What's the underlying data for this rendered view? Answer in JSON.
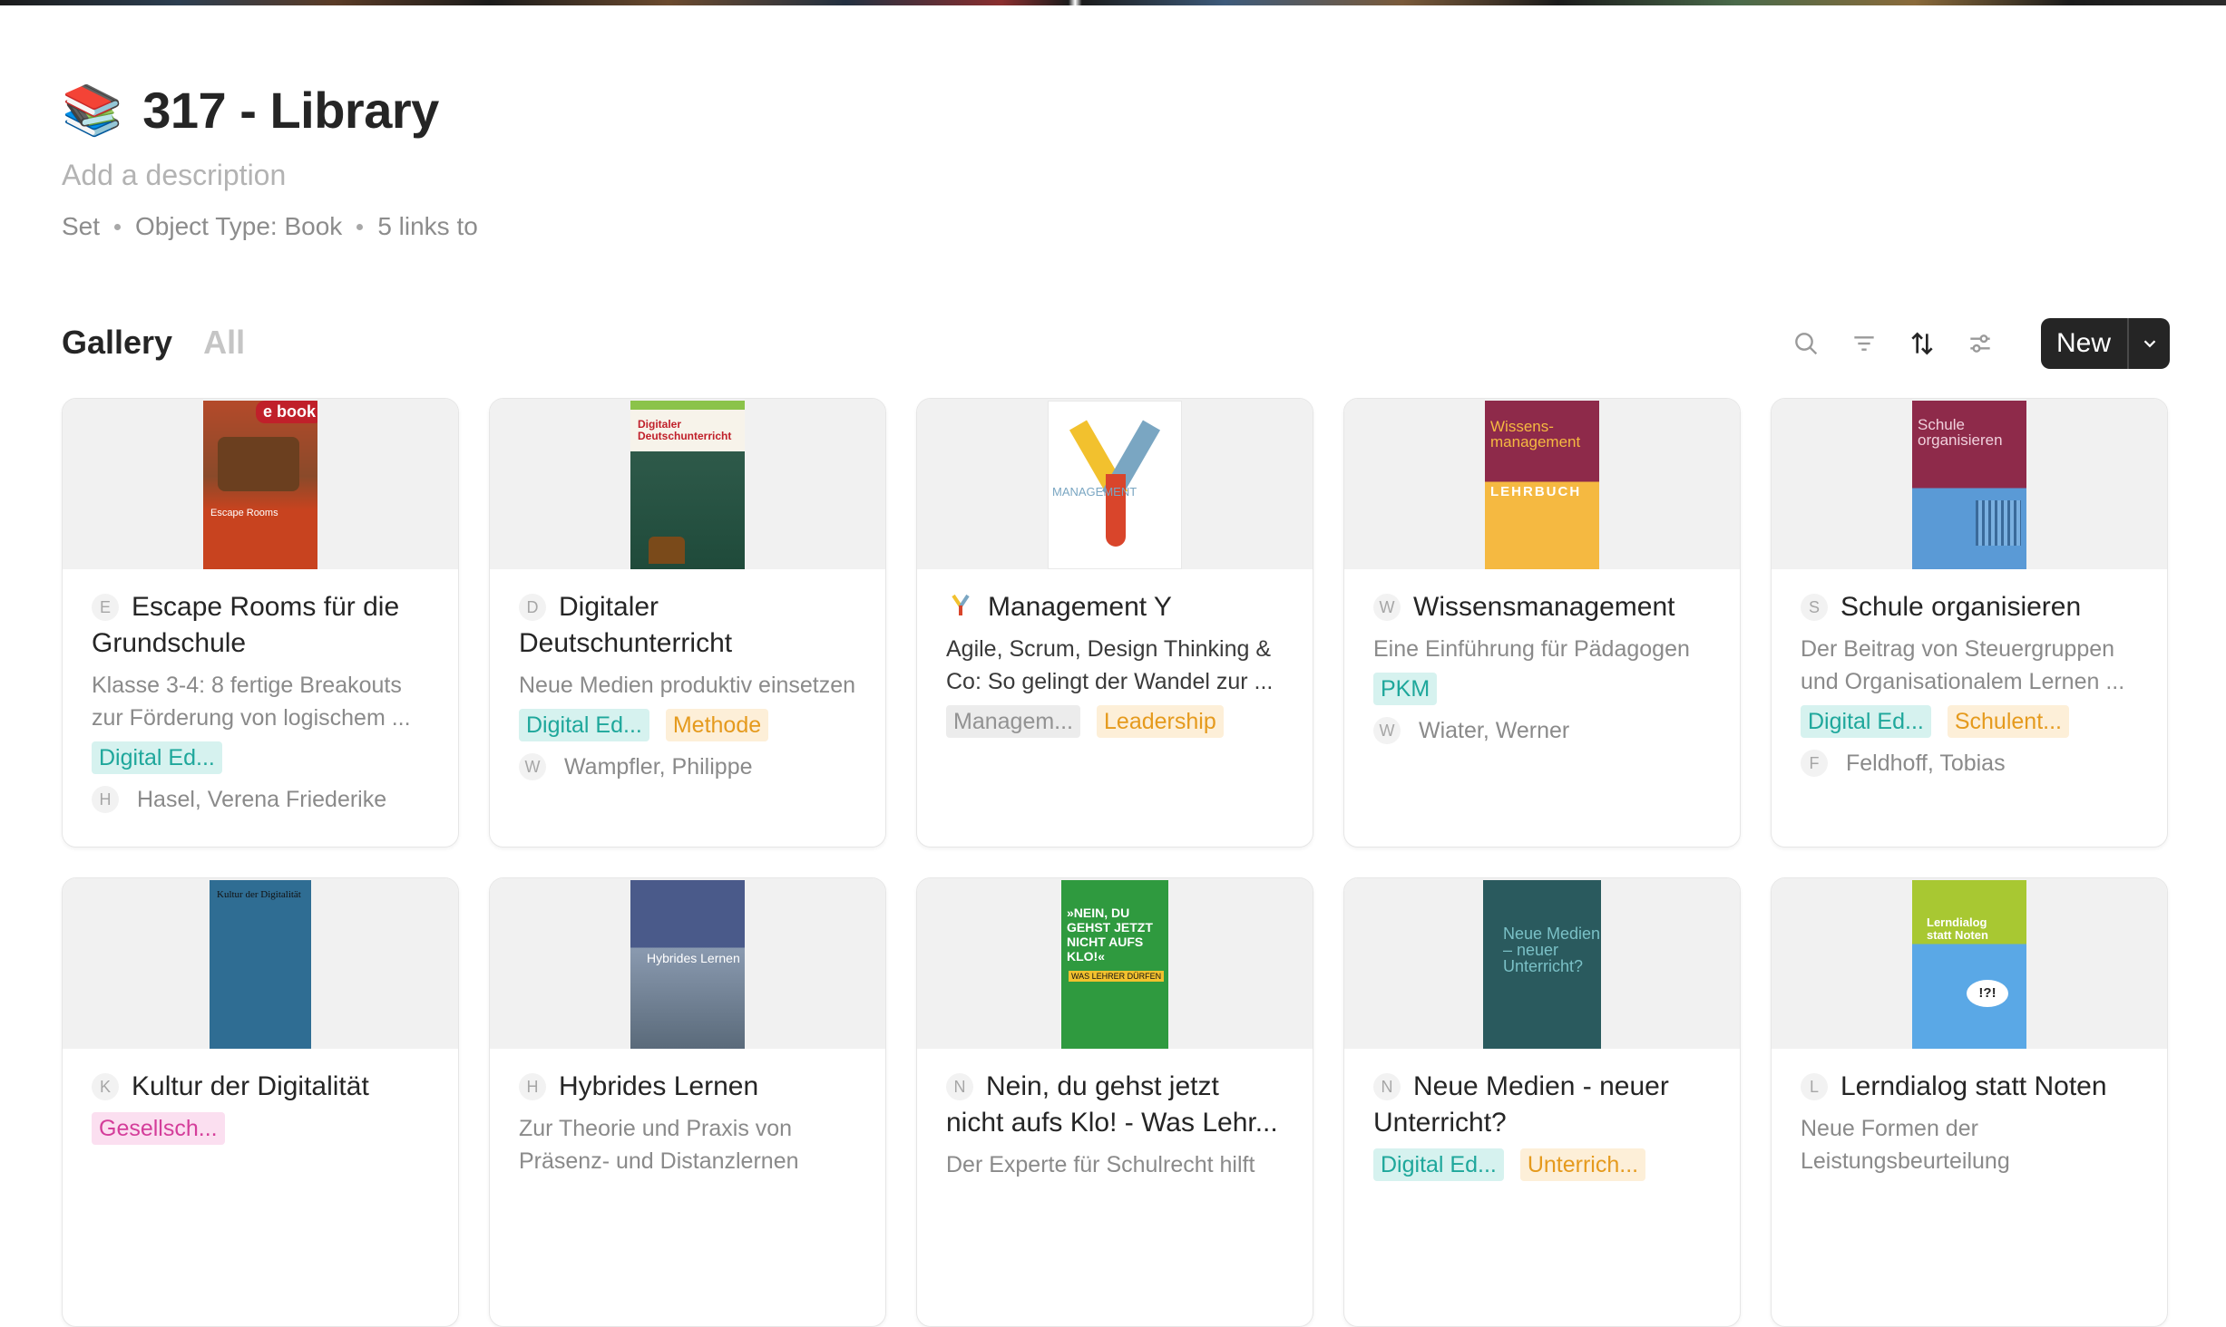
{
  "header": {
    "icon": "books-emoji",
    "title": "317 - Library",
    "description_placeholder": "Add a description",
    "meta": [
      "Set",
      "Object Type: Book",
      "5 links to"
    ]
  },
  "views": {
    "active": "Gallery",
    "inactive": "All"
  },
  "toolbar": {
    "icons": [
      "search-icon",
      "filter-icon",
      "sort-icon",
      "settings-icon"
    ],
    "new_label": "New"
  },
  "cards": [
    {
      "initial": "E",
      "title": "Escape Rooms für die Grundschule",
      "desc": "Klasse 3-4: 8 fertige Breakouts zur Förderung von logischem ...",
      "tags": [
        {
          "label": "Digital Ed...",
          "color": "teal"
        }
      ],
      "author_initial": "H",
      "author": "Hasel, Verena Friederike"
    },
    {
      "initial": "D",
      "title": "Digitaler Deutschunterricht",
      "desc": "Neue Medien produktiv einsetzen",
      "tags": [
        {
          "label": "Digital Ed...",
          "color": "teal"
        },
        {
          "label": "Methode",
          "color": "orange"
        }
      ],
      "author_initial": "W",
      "author": "Wampfler, Philippe"
    },
    {
      "initial": "",
      "title": "Management Y",
      "desc": "Agile, Scrum, Design Thinking & Co: So gelingt der Wandel zur ...",
      "tags": [
        {
          "label": "Managem...",
          "color": "gray"
        },
        {
          "label": "Leadership",
          "color": "orange"
        }
      ],
      "author_initial": "",
      "author": ""
    },
    {
      "initial": "W",
      "title": "Wissensmanagement",
      "desc": "Eine Einführung für Pädagogen",
      "tags": [
        {
          "label": "PKM",
          "color": "teal"
        }
      ],
      "author_initial": "W",
      "author": "Wiater, Werner"
    },
    {
      "initial": "S",
      "title": "Schule organisieren",
      "desc": "Der Beitrag von Steuergruppen und Organisationalem Lernen ...",
      "tags": [
        {
          "label": "Digital Ed...",
          "color": "teal"
        },
        {
          "label": "Schulent...",
          "color": "orange"
        }
      ],
      "author_initial": "F",
      "author": "Feldhoff, Tobias"
    },
    {
      "initial": "K",
      "title": "Kultur der Digitalität",
      "desc": "",
      "tags": [
        {
          "label": "Gesellsch...",
          "color": "pink"
        }
      ],
      "author_initial": "",
      "author": ""
    },
    {
      "initial": "H",
      "title": "Hybrides Lernen",
      "desc": "Zur Theorie und Praxis von Präsenz- und Distanzlernen",
      "tags": [],
      "author_initial": "",
      "author": ""
    },
    {
      "initial": "N",
      "title": "Nein, du gehst jetzt nicht aufs Klo! - Was Lehr...",
      "desc": "Der Experte für Schulrecht hilft",
      "tags": [],
      "author_initial": "",
      "author": ""
    },
    {
      "initial": "N",
      "title": "Neue Medien - neuer Unterricht?",
      "desc": "",
      "tags": [
        {
          "label": "Digital Ed...",
          "color": "teal"
        },
        {
          "label": "Unterrich...",
          "color": "orange"
        }
      ],
      "author_initial": "",
      "author": ""
    },
    {
      "initial": "L",
      "title": "Lerndialog statt Noten",
      "desc": "Neue Formen der Leistungsbeurteilung",
      "tags": [],
      "author_initial": "",
      "author": ""
    }
  ],
  "covers": [
    {
      "text": "e book",
      "sub": "Escape Rooms"
    },
    {
      "text": "Digitaler Deutschunterricht",
      "sub": ""
    },
    {
      "text": "MANAGEMENT",
      "sub": "Y"
    },
    {
      "text": "Wissens-management",
      "sub": "LEHRBUCH"
    },
    {
      "text": "Schule organisieren",
      "sub": ""
    },
    {
      "text": "Kultur der Digitalität",
      "sub": ""
    },
    {
      "text": "Hybrides Lernen",
      "sub": ""
    },
    {
      "text": "»NEIN, DU GEHST JETZT NICHT AUFS KLO!«",
      "sub": "WAS LEHRER DÜRFEN"
    },
    {
      "text": "Neue Medien – neuer Unterricht?",
      "sub": ""
    },
    {
      "text": "Lerndialog statt Noten",
      "sub": "!?!"
    }
  ]
}
